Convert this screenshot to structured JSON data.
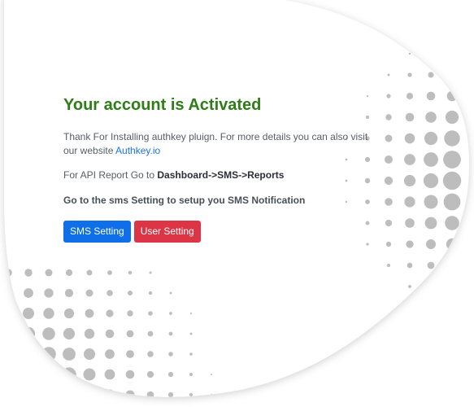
{
  "heading": "Your account is Activated",
  "intro": {
    "text_before_link": "Thank For Installing authkey pluign. For more details you can also visit our website ",
    "link_text": "Authkey.io"
  },
  "api_report": {
    "prefix": "For API Report Go to ",
    "path": "Dashboard->SMS->Reports"
  },
  "setting_note": "Go to the sms Setting to setup you SMS Notification",
  "buttons": {
    "sms_setting": "SMS Setting",
    "user_setting": "User Setting"
  },
  "colors": {
    "heading": "#2e7d18",
    "link": "#1a73e8",
    "sms_button": "#0f6fe8",
    "user_button": "#dc3545",
    "dots": "#bdbdbd"
  }
}
